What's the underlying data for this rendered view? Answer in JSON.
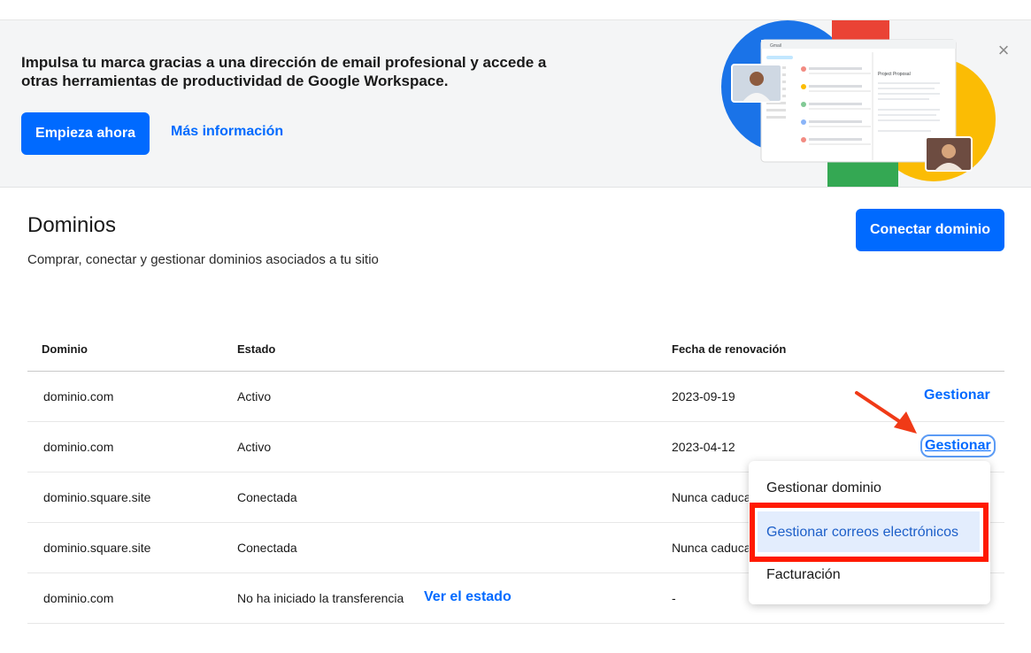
{
  "banner": {
    "text": "Impulsa tu marca gracias a una dirección de email profesional y accede a otras herramientas de productividad de Google Workspace.",
    "start_label": "Empieza ahora",
    "more_label": "Más información",
    "close_glyph": "×",
    "illustration_labels": {
      "gmail": "Gmail",
      "doc_title": "Project Proposal"
    }
  },
  "page": {
    "title": "Dominios",
    "subtitle": "Comprar, conectar y gestionar dominios asociados a tu sitio",
    "connect_label": "Conectar dominio"
  },
  "table": {
    "headers": {
      "domain": "Dominio",
      "status": "Estado",
      "renewal": "Fecha de renovación"
    },
    "rows": [
      {
        "domain": "dominio.com",
        "status": "Activo",
        "date": "2023-09-19",
        "action": "Gestionar"
      },
      {
        "domain": "dominio.com",
        "status": "Activo",
        "date": "2023-04-12",
        "action": "Gestionar"
      },
      {
        "domain": "dominio.square.site",
        "status": "Conectada",
        "date": "Nunca caduca"
      },
      {
        "domain": "dominio.square.site",
        "status": "Conectada",
        "date": "Nunca caduca"
      },
      {
        "domain": "dominio.com",
        "status": "No ha iniciado la transferencia",
        "link": "Ver el estado",
        "date": "-"
      }
    ]
  },
  "menu": {
    "items": [
      "Gestionar dominio",
      "Gestionar correos electrónicos",
      "Facturación"
    ]
  },
  "colors": {
    "accent": "#006aff",
    "highlight": "#ff1a00",
    "arrow": "#f03a17"
  }
}
